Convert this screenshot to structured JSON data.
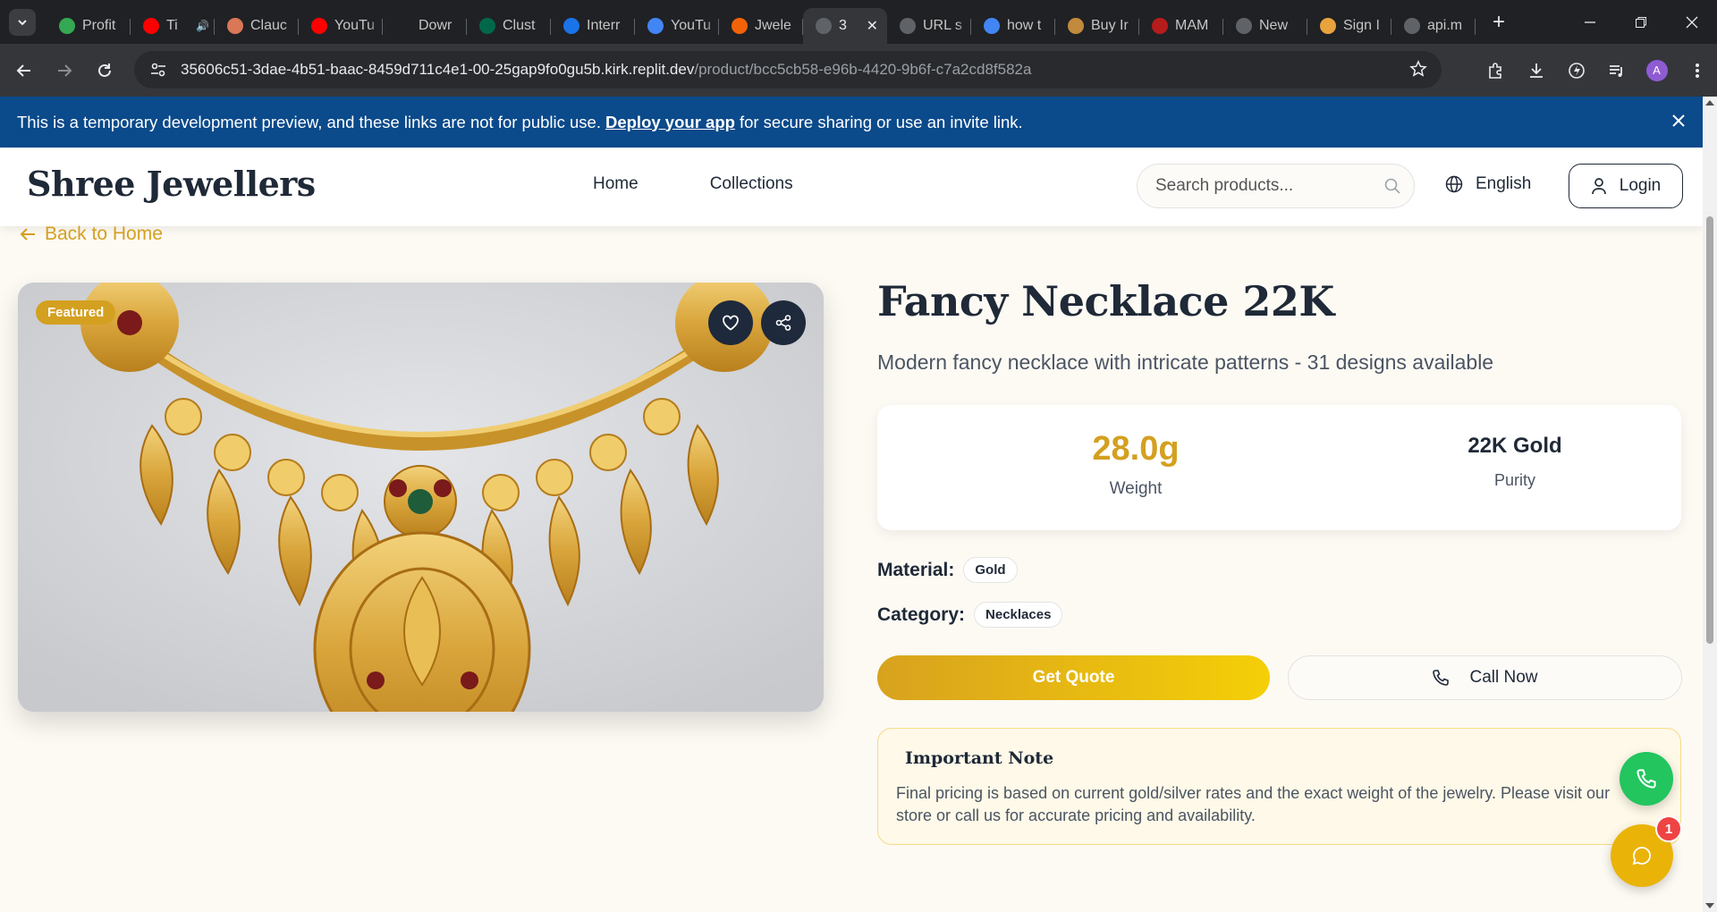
{
  "browser": {
    "tabs": [
      {
        "title": "Profit",
        "favicon_color": "#34a853",
        "icon": "leaf-icon"
      },
      {
        "title": "Ti",
        "favicon_color": "#ff0000",
        "icon": "youtube-icon",
        "audio": true
      },
      {
        "title": "Clauc",
        "favicon_color": "#d97757",
        "icon": "claude-icon"
      },
      {
        "title": "YouTu",
        "favicon_color": "#ff0000",
        "icon": "youtube-icon"
      },
      {
        "title": "Dowr",
        "favicon_color": "#202124",
        "icon": "download-icon"
      },
      {
        "title": "Clust",
        "favicon_color": "#00684a",
        "icon": "mongodb-icon"
      },
      {
        "title": "Interr",
        "favicon_color": "#1a73e8",
        "icon": "is-icon"
      },
      {
        "title": "YouTu",
        "favicon_color": "#4285f4",
        "icon": "google-icon"
      },
      {
        "title": "Jwele",
        "favicon_color": "#f26207",
        "icon": "replit-icon"
      },
      {
        "title": "3",
        "favicon_color": "#5f6368",
        "icon": "globe-icon",
        "active": true
      },
      {
        "title": "URL s",
        "favicon_color": "#5f6368",
        "icon": "openai-icon"
      },
      {
        "title": "how t",
        "favicon_color": "#4285f4",
        "icon": "google-icon"
      },
      {
        "title": "Buy Ir",
        "favicon_color": "#c28a3c",
        "icon": "t-icon"
      },
      {
        "title": "MAM",
        "favicon_color": "#b71c1c",
        "icon": "mam-icon"
      },
      {
        "title": "New",
        "favicon_color": "#5f6368",
        "icon": "chrome-icon"
      },
      {
        "title": "Sign I",
        "favicon_color": "#e8a33d",
        "icon": "sign-icon"
      },
      {
        "title": "api.m",
        "favicon_color": "#5f6368",
        "icon": "globe-icon"
      }
    ],
    "url_host": "35606c51-3dae-4b51-baac-8459d711c4e1-00-25gap9fo0gu5b.kirk.replit.dev",
    "url_path": "/product/bcc5cb58-e96b-4420-9b6f-c7a2cd8f582a",
    "profile_initial": "A"
  },
  "banner": {
    "text_before": "This is a temporary development preview, and these links are not for public use.",
    "link": "Deploy your app",
    "text_after": "for secure sharing or use an invite link."
  },
  "header": {
    "brand": "Shree Jewellers",
    "nav": [
      "Home",
      "Collections"
    ],
    "search_placeholder": "Search products...",
    "language": "English",
    "login": "Login"
  },
  "back_link": "Back to Home",
  "product": {
    "badge": "Featured",
    "title": "Fancy Necklace 22K",
    "description": "Modern fancy necklace with intricate patterns - 31 designs available",
    "weight_value": "28.0g",
    "weight_label": "Weight",
    "purity_value": "22K Gold",
    "purity_label": "Purity",
    "material_label": "Material:",
    "material": "Gold",
    "category_label": "Category:",
    "category": "Necklaces",
    "quote_button": "Get Quote",
    "call_button": "Call Now"
  },
  "note": {
    "title": "Important Note",
    "text": "Final pricing is based on current gold/silver rates and the exact weight of the jewelry. Please visit our store or call us for accurate pricing and availability."
  },
  "chat_badge_count": "1",
  "colors": {
    "accent_gold": "#d4a020",
    "banner_blue": "#0b4a8b",
    "dark": "#1f2937",
    "whatsapp_green": "#22c55e"
  }
}
